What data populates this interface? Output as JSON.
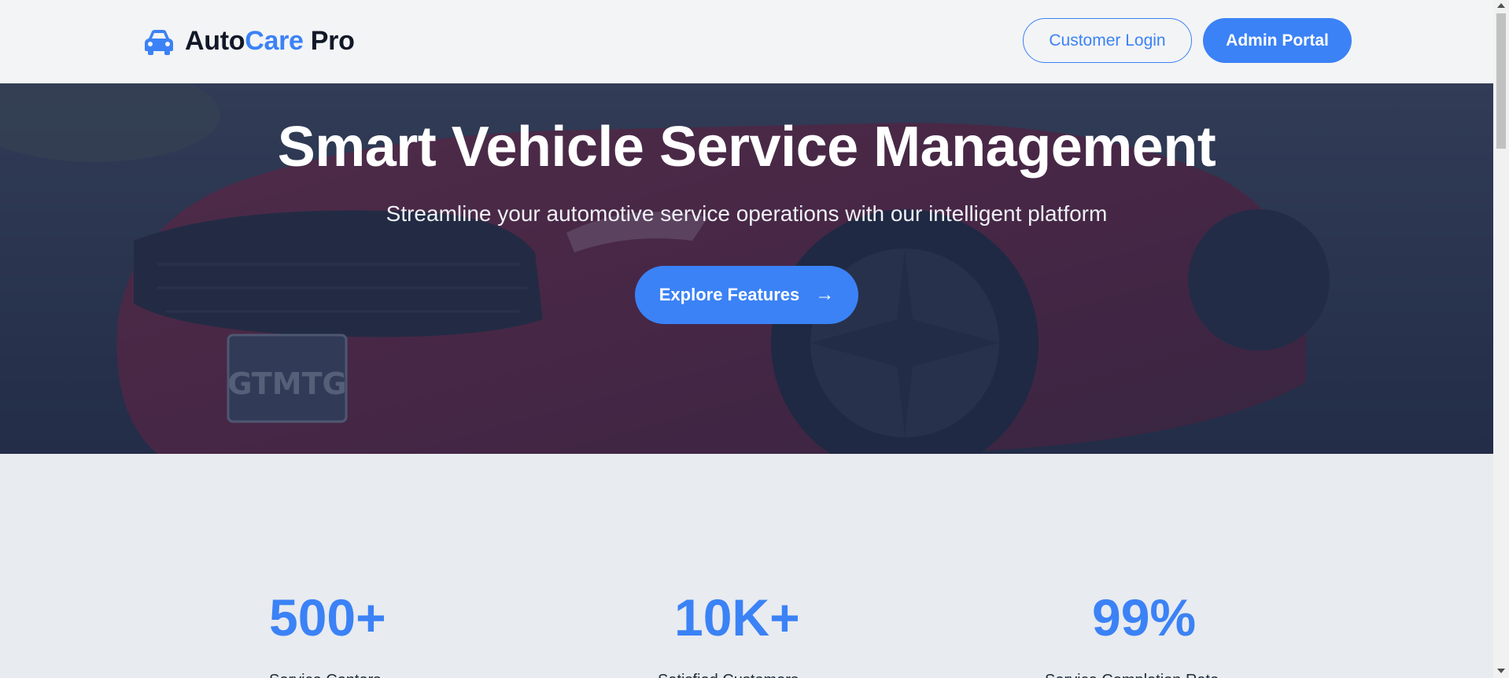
{
  "brand": {
    "prefix": "Auto",
    "accent": "Care",
    "suffix": " Pro",
    "icon": "car-icon"
  },
  "nav": {
    "customer_login": "Customer Login",
    "admin_portal": "Admin Portal"
  },
  "hero": {
    "title": "Smart Vehicle Service Management",
    "subtitle": "Streamline your automotive service operations with our intelligent platform",
    "cta_label": "Explore Features",
    "cta_icon": "arrow-right-icon",
    "background_image": "red-car-photo"
  },
  "stats": [
    {
      "value": "500+",
      "label": "Service Centers"
    },
    {
      "value": "10K+",
      "label": "Satisfied Customers"
    },
    {
      "value": "99%",
      "label": "Service Completion Rate"
    }
  ],
  "colors": {
    "accent": "#3b82f6",
    "dark": "#111827",
    "hero_overlay": "#2b3550"
  }
}
